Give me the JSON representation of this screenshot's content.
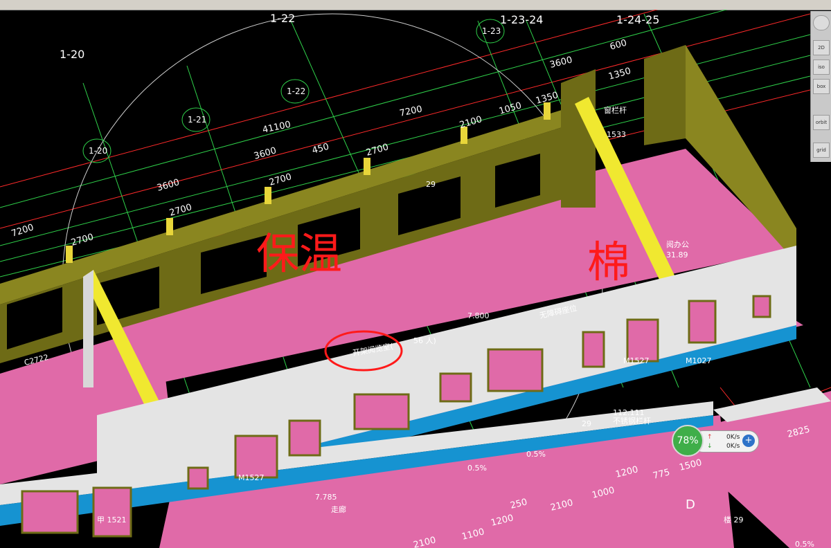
{
  "axes": {
    "a1": "1-20",
    "a2": "1-22",
    "a3": "1-23-24",
    "a4": "1-24-25",
    "b1": "1-20",
    "b2": "1-21",
    "b3": "1-22",
    "b4": "1-23"
  },
  "dims": {
    "d7200a": "7200",
    "d41100": "41100",
    "d7200b": "7200",
    "d3600a": "3600",
    "d3600b": "3600",
    "d3600c": "3600",
    "d2700a": "2700",
    "d2700b": "2700",
    "d2700c": "2700",
    "d2700d": "2700",
    "d450": "450",
    "d2100": "2100",
    "d1050": "1050",
    "d1350a": "1350",
    "d1350b": "1350",
    "d600": "600",
    "d2825": "2825",
    "d1200a": "1200",
    "d1000": "1000",
    "d775": "775",
    "d1500": "1500",
    "d250": "250",
    "d2100b": "2100",
    "d1200b": "1200",
    "d1100": "1100",
    "d2100c": "2100"
  },
  "labels": {
    "room_open": "开架阅览室(",
    "persons": "56  人)",
    "barrier_free": "无障碍座位",
    "reading_elev": "7.800",
    "corridor": "走廊",
    "corridor_elev": "7.785",
    "office": "阅办公",
    "office_area": "31.89",
    "slope_a": "0.5%",
    "slope_b": "0.5%",
    "slope_c": "0.5%",
    "room_no": "29",
    "room_no2": "29",
    "stair_no": "楼 29",
    "grid_d": "D",
    "window_c2722": "C2722",
    "door_m1527a": "M1527",
    "door_m1527b": "M1527",
    "door_m1027": "M1027",
    "door_m1521": "甲 1521",
    "rail": "窗栏杆",
    "rail2": "不锈钢栏杆",
    "code_1533": "1533",
    "code_112": "112.111",
    "overlay_a": "保温",
    "overlay_b": "棉"
  },
  "toolbar": {
    "b2d": "2D",
    "iso": "iso",
    "box": "box",
    "orbit": "orbit",
    "grid": "grid"
  },
  "network": {
    "percent": "78%",
    "up": "0K/s",
    "down": "0K/s"
  },
  "colors": {
    "floor": "#e06aa8",
    "wall": "#e4e4e4",
    "wall_side": "#6e6b16",
    "wall_top": "#8a8620",
    "band": "#1693d1",
    "grid_green": "#21c238",
    "grid_red": "#e0202a",
    "markup": "#ff1a1a"
  }
}
